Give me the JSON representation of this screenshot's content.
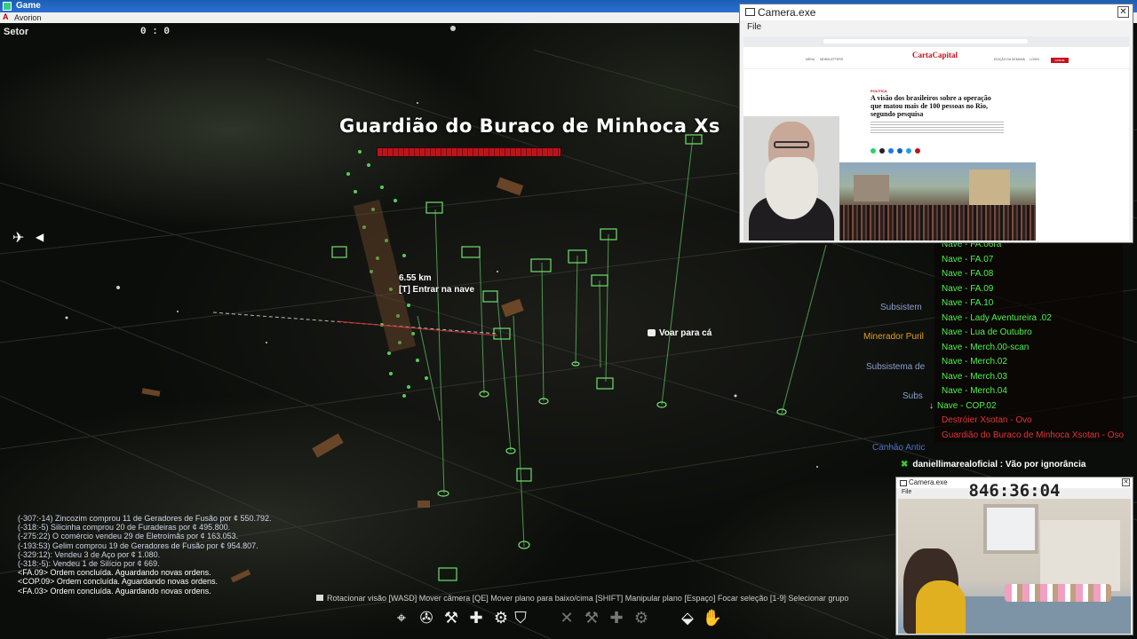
{
  "os": {
    "window_title": "Game",
    "app_subtitle": "Avorion"
  },
  "hud": {
    "sector_label": "Setor",
    "sector_coords": "0 : 0",
    "boss_name": "Guardião do Buraco de Minhoca Xs",
    "boss_health_fraction": 1.0,
    "distance": "6.55 km",
    "enter_ship": "[T] Entrar na nave",
    "fly_here": "Voar para cá"
  },
  "side_labels": [
    {
      "text": "Subsistem",
      "color": "#8aa0d0"
    },
    {
      "text": "Minerador Puril",
      "color": "#e0a020"
    },
    {
      "text": "Subsistema de",
      "color": "#8aa0d0"
    },
    {
      "text": "Subs",
      "color": "#8aa0d0"
    },
    {
      "text": "Canhão Antic",
      "color": "#4a70d0"
    }
  ],
  "fleet": [
    {
      "label": "Nave - FA.06ra",
      "color": "green"
    },
    {
      "label": "Nave - FA.07",
      "color": "green"
    },
    {
      "label": "Nave - FA.08",
      "color": "green"
    },
    {
      "label": "Nave - FA.09",
      "color": "green"
    },
    {
      "label": "Nave - FA.10",
      "color": "green"
    },
    {
      "label": "Nave - Lady Aventureira .02",
      "color": "green"
    },
    {
      "label": "Nave - Lua de Outubro",
      "color": "green"
    },
    {
      "label": "Nave - Merch.00-scan",
      "color": "green"
    },
    {
      "label": "Nave - Merch.02",
      "color": "green"
    },
    {
      "label": "Nave - Merch.03",
      "color": "green"
    },
    {
      "label": "Nave - Merch.04",
      "color": "green"
    },
    {
      "label": "Nave - COP.02",
      "color": "green",
      "marker": "↓"
    },
    {
      "label": "Destróier Xsotan - Ovo",
      "color": "red"
    },
    {
      "label": "Guardião do Buraco de Minhoca Xsotan - Oso",
      "color": "red"
    }
  ],
  "chat": {
    "user": "daniellimarealoficial",
    "message": "Vão por ignorância"
  },
  "log": [
    "(-307:-14) Zincozim comprou 11 de Geradores de Fusão por ¢ 550.792.",
    "(-318:-5) Silicinha comprou 20 de Furadeiras por ¢ 495.800.",
    "(-275:22) O comércio vendeu 29 de Eletroímãs por ¢ 163.053.",
    "(-193:53) Gelim comprou 19 de Geradores de Fusão por ¢ 954.807.",
    "(-329:12): Vendeu 3 de Aço por ¢ 1.080.",
    "(-318:-5): Vendeu 1 de Silício por ¢ 669.",
    "<FA.09> Ordem concluída. Aguardando novas ordens.",
    "<COP.09> Ordem concluída. Aguardando novas ordens.",
    "<FA.03> Ordem concluída. Aguardando novas ordens."
  ],
  "hints": "Rotacionar visão  [WASD] Mover câmera  [QE] Mover plano para baixo/cima  [SHIFT] Manipular plano  [Espaço] Focar seleção  [1-9] Selecionar grupo",
  "toolbar": [
    {
      "icon": "crosshair-icon",
      "glyph": "⌖"
    },
    {
      "icon": "ship-build-icon",
      "glyph": "✇"
    },
    {
      "icon": "wrench-icon",
      "glyph": "⚒"
    },
    {
      "icon": "plus-icon",
      "glyph": "✚"
    },
    {
      "icon": "turret-icon",
      "glyph": "⚙"
    },
    {
      "icon": "shield-icon",
      "glyph": "⛉"
    },
    {
      "icon": "dim-tool-1-icon",
      "glyph": "✕"
    },
    {
      "icon": "dim-tool-2-icon",
      "glyph": "⚒"
    },
    {
      "icon": "dim-tool-3-icon",
      "glyph": "✚"
    },
    {
      "icon": "dim-tool-4-icon",
      "glyph": "⚙"
    },
    {
      "icon": "eraser-icon",
      "glyph": "⬙"
    },
    {
      "icon": "hand-icon",
      "glyph": "✋"
    }
  ],
  "camera1": {
    "title": "Camera.exe",
    "menu_file": "File",
    "close": "✕",
    "page": {
      "logo": "CartaCapital",
      "nav": [
        "MENU",
        "NEWSLETTERS",
        "EDIÇÃO DA SEMANA",
        "LOGIN"
      ],
      "button": "ASSINE",
      "tag": "POLÍTICA",
      "headline": "A visão dos brasileiros sobre a operação que matou mais de 100 pessoas no Rio, segundo pesquisa"
    }
  },
  "camera2": {
    "title": "Camera.exe",
    "menu_file": "File",
    "close": "✕",
    "timer": "846:36:04"
  }
}
